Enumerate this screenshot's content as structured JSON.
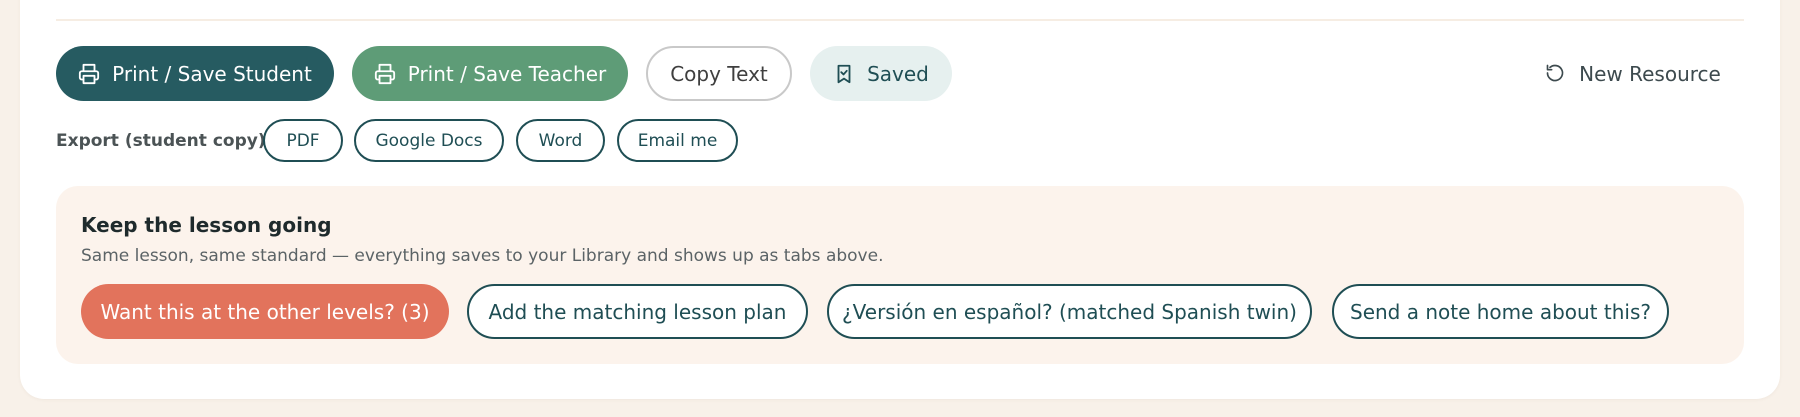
{
  "actions": {
    "print_student_label": "Print / Save Student",
    "print_teacher_label": "Print / Save Teacher",
    "copy_text_label": "Copy Text",
    "saved_label": "Saved",
    "new_resource_label": "New Resource"
  },
  "export": {
    "label": "Export (student copy):",
    "options": [
      "PDF",
      "Google Docs",
      "Word",
      "Email me"
    ]
  },
  "continue_panel": {
    "title": "Keep the lesson going",
    "subtitle": "Same lesson, same standard — everything saves to your Library and shows up as tabs above.",
    "buttons": [
      "Want this at the other levels? (3)",
      "Add the matching lesson plan",
      "¿Versión en español? (matched Spanish twin)",
      "Send a note home about this?"
    ]
  },
  "icons": {
    "print": "printer-icon",
    "saved": "bookmark-check-icon",
    "new_resource": "refresh-icon"
  },
  "colors": {
    "page_background": "#f8f1e9",
    "card_background": "#ffffff",
    "student_button": "#265b61",
    "teacher_button": "#5e9c77",
    "saved_button": "#e6f0ef",
    "accent_outline": "#1f4e54",
    "primary_cta": "#e2735c",
    "panel_background": "#fcf3ec"
  }
}
